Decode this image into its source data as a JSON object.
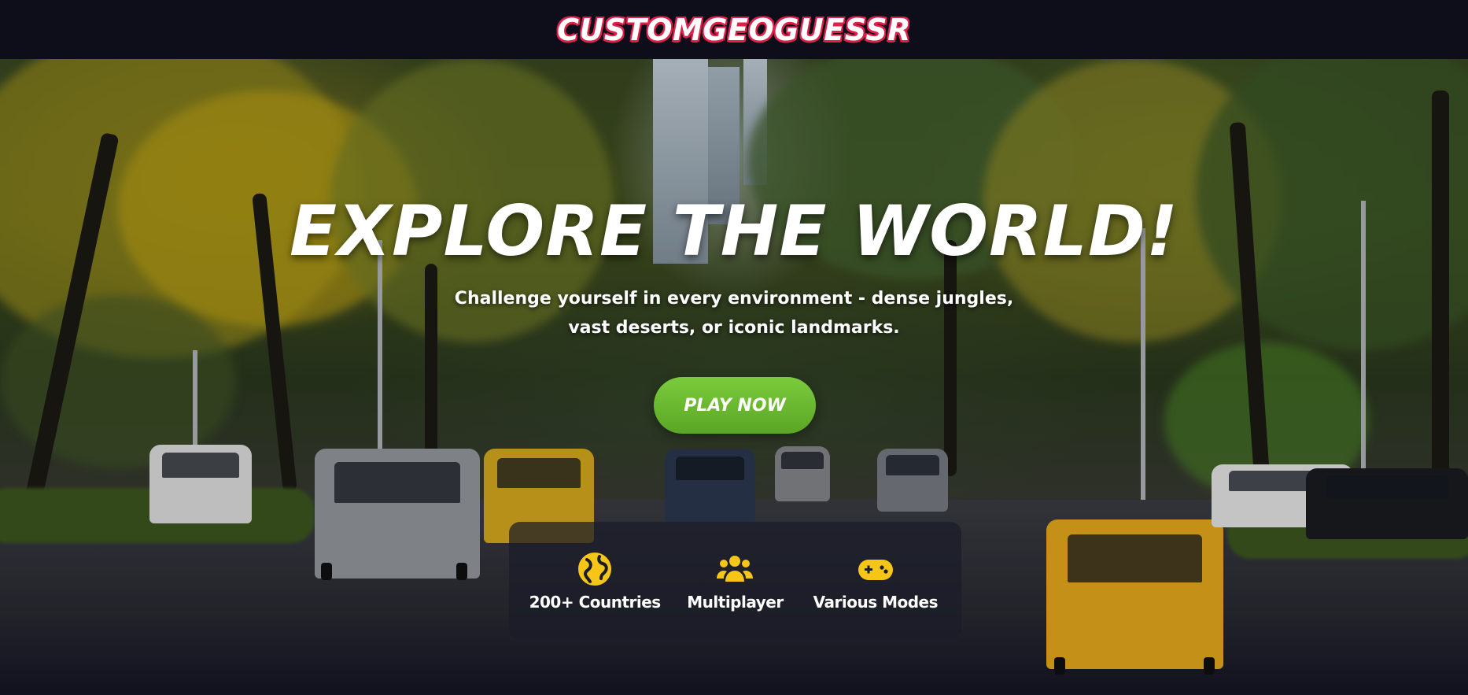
{
  "header": {
    "logo_text": "CUSTOMGEOGUESSR"
  },
  "hero": {
    "headline": "EXPLORE THE WORLD!",
    "subtitle": "Challenge yourself in every environment - dense jungles, vast deserts, or iconic landmarks.",
    "cta_label": "PLAY NOW"
  },
  "features": [
    {
      "icon": "globe-icon",
      "label": "200+ Countries"
    },
    {
      "icon": "users-icon",
      "label": "Multiplayer"
    },
    {
      "icon": "gamepad-icon",
      "label": "Various Modes"
    }
  ],
  "colors": {
    "logo_outline": "#e0204a",
    "cta_green": "#6ab82f",
    "icon_yellow": "#f5c518",
    "page_bg": "#0e0e1a"
  }
}
